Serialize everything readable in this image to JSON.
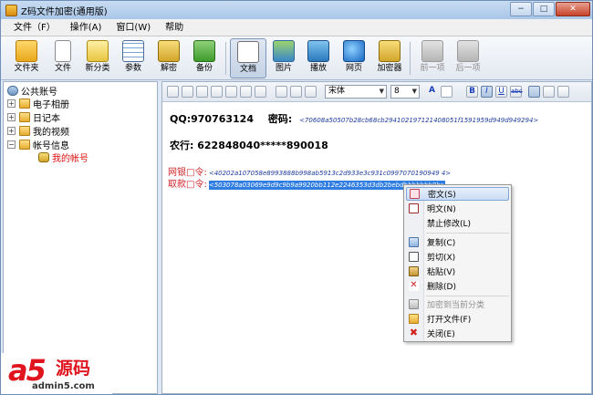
{
  "window": {
    "title": "Z码文件加密(通用版)",
    "controls": [
      "−",
      "□",
      "✕"
    ]
  },
  "menubar": {
    "items": [
      "文件（F）",
      "操作(A)",
      "窗口(W)",
      "帮助"
    ]
  },
  "toolbar": {
    "buttons": [
      {
        "label": "文件夹",
        "icon": "folder-icon"
      },
      {
        "label": "文件",
        "icon": "file-icon"
      },
      {
        "label": "新分类",
        "icon": "new-category-icon"
      },
      {
        "label": "参数",
        "icon": "settings-grid-icon"
      },
      {
        "label": "解密",
        "icon": "unlock-icon"
      },
      {
        "label": "备份",
        "icon": "backup-icon"
      },
      {
        "label": "文档",
        "icon": "document-icon",
        "active": true
      },
      {
        "label": "图片",
        "icon": "picture-icon"
      },
      {
        "label": "播放",
        "icon": "play-icon"
      },
      {
        "label": "网页",
        "icon": "ie-browser-icon"
      },
      {
        "label": "加密器",
        "icon": "lock-icon"
      },
      {
        "label": "前一项",
        "icon": "previous-icon",
        "disabled": true
      },
      {
        "label": "后一项",
        "icon": "next-icon",
        "disabled": true
      }
    ]
  },
  "tree": {
    "root": "公共账号",
    "items": [
      {
        "label": "电子相册",
        "expander": "+"
      },
      {
        "label": "日记本",
        "expander": "+"
      },
      {
        "label": "我的视频",
        "expander": "+"
      },
      {
        "label": "帐号信息",
        "expander": "−"
      }
    ],
    "child": "我的帐号"
  },
  "format_bar": {
    "font_name": "宋体",
    "font_size": "8",
    "bold": "B",
    "italic": "I",
    "underline": "U",
    "strike": "abc",
    "color_a": "A"
  },
  "document": {
    "qq_label": "QQ:970763124",
    "password_label": "密码:",
    "qq_cipher": "<70608a50507b28cb68cb294102197121408051f1591959d949d949294>",
    "bank_line": "农行: 622848040*****890018",
    "web_label": "网银□令:",
    "web_cipher": "<40202a107058e8993888b998ab5913c2d933e3c931c0997070190949 4>",
    "pay_label": "取款□令:",
    "pay_cipher": "<503078a03069e9d9c9b9a9920bb112e2246353d3db2bebdbbbbbbb8b>"
  },
  "context_menu": {
    "items": [
      {
        "label": "密文(S)",
        "icon": "cipher-text-icon",
        "highlighted": true
      },
      {
        "label": "明文(N)",
        "icon": "plain-text-icon"
      },
      {
        "label": "禁止修改(L)",
        "icon": ""
      },
      {
        "label": "复制(C)",
        "icon": "copy-icon"
      },
      {
        "label": "剪切(X)",
        "icon": "cut-icon"
      },
      {
        "label": "粘贴(V)",
        "icon": "paste-icon"
      },
      {
        "label": "删除(D)",
        "icon": "delete-icon"
      },
      {
        "label": "加密到当前分类",
        "icon": "lock-icon",
        "disabled": true
      },
      {
        "label": "打开文件(F)",
        "icon": "open-folder-icon"
      },
      {
        "label": "关闭(E)",
        "icon": "close-icon"
      }
    ]
  },
  "watermark": {
    "logo_a5": "a5",
    "logo_cn": "源码",
    "url": "admin5.com"
  },
  "colors": {
    "accent": "#2f7de1",
    "alert_red": "#d0232a",
    "cipher_blue": "#1c3b9c"
  }
}
